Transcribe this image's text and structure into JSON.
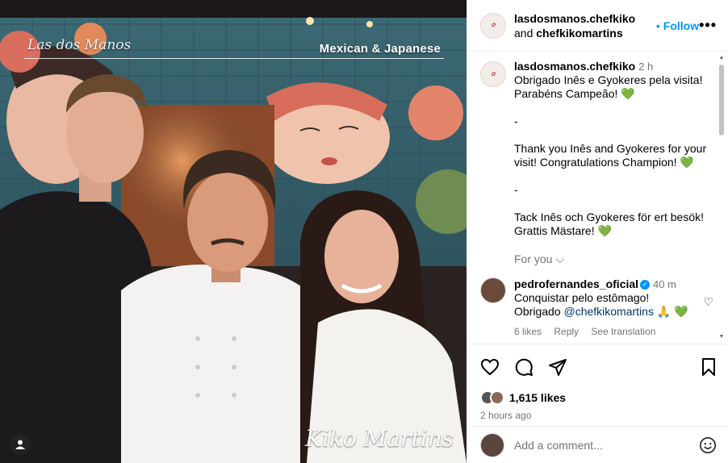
{
  "photo": {
    "brand_script": "Las dos Manos",
    "cuisine_text": "Mexican & Japanese",
    "signature": "Kiko Martins"
  },
  "header": {
    "user1": "lasdosmanos.chefkiko",
    "and_text": "and",
    "user2": "chefkikomartins",
    "separator": "•",
    "follow_label": "Follow",
    "more_label": "•••"
  },
  "caption": {
    "username": "lasdosmanos.chefkiko",
    "time": "2 h",
    "paragraphs": [
      "Obrigado Inês e Gyokeres pela visita! Parabéns Campeão! 💚",
      "-",
      "Thank you Inês and Gyokeres for your visit! Congratulations Champion! 💚",
      "-",
      "Tack Inês och Gyokeres för ert besök! Grattis Mästare! 💚"
    ],
    "for_you": "For you"
  },
  "comment": {
    "username": "pedrofernandes_oficial",
    "time": "40 m",
    "text_before": "Conquistar pelo estômago! Obrigado ",
    "mention": "@chefkikomartins",
    "text_after": " 🙏 💚",
    "likes": "6 likes",
    "reply": "Reply",
    "see_translation": "See translation"
  },
  "stats": {
    "likes": "1,615 likes",
    "age": "2 hours ago"
  },
  "composer": {
    "placeholder": "Add a comment..."
  },
  "colors": {
    "accent": "#0095f6",
    "heart": "#2ecc71"
  }
}
